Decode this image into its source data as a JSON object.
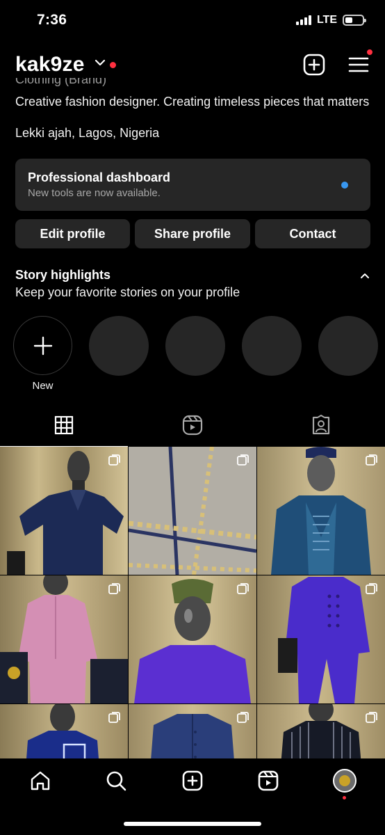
{
  "status": {
    "time": "7:36",
    "network": "LTE",
    "battery_level": 0.45
  },
  "header": {
    "username": "kak9ze",
    "icons": [
      "chevron-down-icon",
      "create-post-icon",
      "menu-icon"
    ]
  },
  "bio": {
    "category": "Clothing (Brand)",
    "text": "Creative fashion designer. Creating timeless pieces that matters",
    "location": "Lekki ajah, Lagos, Nigeria"
  },
  "dashboard": {
    "title": "Professional dashboard",
    "subtitle": "New tools are now available."
  },
  "buttons": {
    "edit": "Edit profile",
    "share": "Share profile",
    "contact": "Contact"
  },
  "highlights": {
    "title": "Story highlights",
    "subtitle": "Keep your favorite stories on your profile",
    "new_label": "New"
  },
  "tabs": [
    "grid-icon",
    "reels-icon",
    "tagged-icon"
  ],
  "posts": [
    {
      "subject": "navy short-sleeve shirt",
      "multi": true
    },
    {
      "subject": "fabric close-up",
      "multi": true
    },
    {
      "subject": "embroidered blue agbada with cap",
      "multi": true
    },
    {
      "subject": "pink kaftan",
      "multi": true
    },
    {
      "subject": "purple kaftan with green cap",
      "multi": true
    },
    {
      "subject": "purple double-breasted outfit",
      "multi": true
    },
    {
      "subject": "navy outfit with white pocket",
      "multi": true
    },
    {
      "subject": "blue buttoned shirt",
      "multi": true
    },
    {
      "subject": "black striped shirt",
      "multi": true
    }
  ],
  "nav": [
    "home-icon",
    "search-icon",
    "create-icon",
    "reels-icon",
    "profile-avatar"
  ],
  "colors": {
    "background": "#000000",
    "card": "#262626",
    "accent_blue": "#3897f0",
    "notification_red": "#ff3040"
  }
}
